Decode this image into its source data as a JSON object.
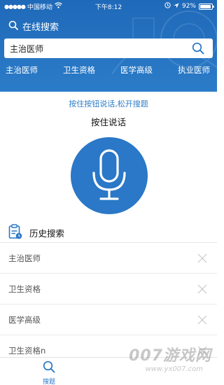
{
  "status_bar": {
    "signal_dots": "●●●●●",
    "carrier": "中国移动",
    "time": "下午8:12",
    "battery": "92%",
    "battery_level": 0.92
  },
  "header": {
    "online_search": "在线搜索"
  },
  "search": {
    "value": "主治医师"
  },
  "tabs": [
    {
      "label": "主治医师"
    },
    {
      "label": "卫生资格"
    },
    {
      "label": "医学高级"
    },
    {
      "label": "执业医师"
    }
  ],
  "voice": {
    "hint": "按住按钮说话,松开搜题",
    "title": "按住说话"
  },
  "history": {
    "title": "历史搜索",
    "items": [
      {
        "text": "主治医师"
      },
      {
        "text": "卫生资格"
      },
      {
        "text": "医学高级"
      },
      {
        "text": "卫生资格n"
      }
    ]
  },
  "bottom_nav": {
    "search_label": "搜题"
  },
  "watermark": {
    "main": "007游戏网",
    "sub": "www.yx007.com"
  },
  "colors": {
    "brand_blue": "#2a78c7",
    "header_blue": "#1f69b9"
  }
}
